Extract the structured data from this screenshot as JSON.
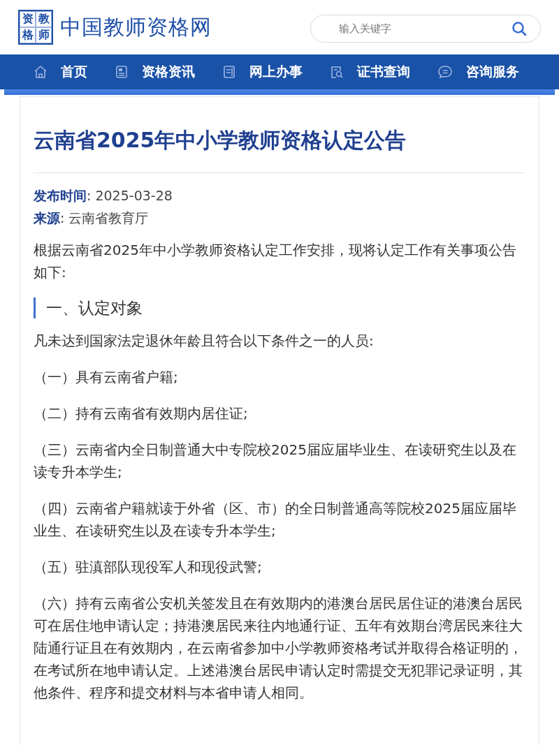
{
  "header": {
    "logo_chars": [
      "资",
      "教",
      "格",
      "师"
    ],
    "site_name": "中国教师资格网",
    "search": {
      "placeholder": "输入关键字"
    }
  },
  "nav": [
    {
      "label": "首页",
      "kind": "home"
    },
    {
      "label": "资格资讯",
      "kind": "news"
    },
    {
      "label": "网上办事",
      "kind": "document"
    },
    {
      "label": "证书查询",
      "kind": "lookup"
    },
    {
      "label": "咨询服务",
      "kind": "chat"
    }
  ],
  "article": {
    "title": "云南省2025年中小学教师资格认定公告",
    "meta": [
      "**发布时间**: 2025-03-28",
      "**来源**: 云南省教育厅"
    ],
    "blocks": [
      {
        "kind": "paragraph",
        "text": "根据云南省2025年中小学教师资格认定工作安排，现将认定工作有关事项公告如下:"
      },
      {
        "kind": "heading",
        "text": "一、认定对象"
      },
      {
        "kind": "paragraph",
        "text": "凡未达到国家法定退休年龄且符合以下条件之一的人员:"
      },
      {
        "kind": "paragraph",
        "text": "（一）具有云南省户籍;"
      },
      {
        "kind": "paragraph",
        "text": "（二）持有云南省有效期内居住证;"
      },
      {
        "kind": "paragraph",
        "text": "（三）云南省内全日制普通大中专院校2025届应届毕业生、在读研究生以及在读专升本学生;"
      },
      {
        "kind": "paragraph",
        "text": "（四）云南省户籍就读于外省（区、市）的全日制普通高等院校2025届应届毕业生、在读研究生以及在读专升本学生;"
      },
      {
        "kind": "paragraph",
        "text": "（五）驻滇部队现役军人和现役武警;"
      },
      {
        "kind": "paragraph",
        "text": "（六）持有云南省公安机关签发且在有效期内的港澳台居民居住证的港澳台居民可在居住地申请认定；持港澳居民来往内地通行证、五年有效期台湾居民来往大陆通行证且在有效期内，在云南省参加中小学教师资格考试并取得合格证明的，在考试所在地申请认定。上述港澳台居民申请认定时需提交无犯罪记录证明，其他条件、程序和提交材料与本省申请人相同。"
      }
    ]
  }
}
